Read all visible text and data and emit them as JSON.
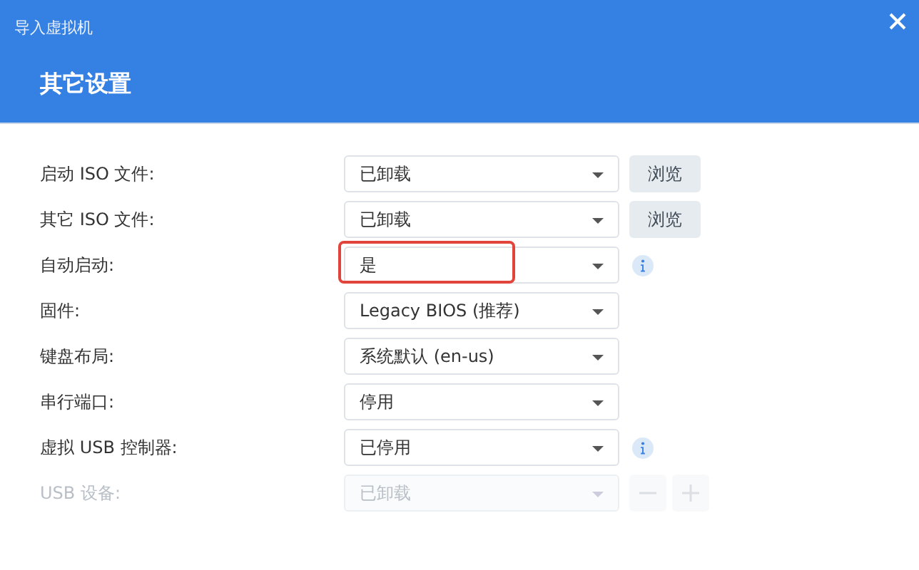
{
  "window": {
    "title": "导入虚拟机"
  },
  "section_title": "其它设置",
  "settings": [
    {
      "label": "启动 ISO 文件:",
      "value": "已卸载",
      "disabled": false,
      "highlighted": false,
      "kind": "browse",
      "button": "浏览"
    },
    {
      "label": "其它 ISO 文件:",
      "value": "已卸载",
      "disabled": false,
      "highlighted": false,
      "kind": "browse",
      "button": "浏览"
    },
    {
      "label": "自动启动:",
      "value": "是",
      "disabled": false,
      "highlighted": true,
      "kind": "info"
    },
    {
      "label": "固件:",
      "value": "Legacy BIOS (推荐)",
      "disabled": false,
      "highlighted": false,
      "kind": "plain"
    },
    {
      "label": "键盘布局:",
      "value": "系统默认 (en-us)",
      "disabled": false,
      "highlighted": false,
      "kind": "plain"
    },
    {
      "label": "串行端口:",
      "value": "停用",
      "disabled": false,
      "highlighted": false,
      "kind": "plain"
    },
    {
      "label": "虚拟 USB 控制器:",
      "value": "已停用",
      "disabled": false,
      "highlighted": false,
      "kind": "info"
    },
    {
      "label": "USB 设备:",
      "value": "已卸载",
      "disabled": true,
      "highlighted": false,
      "kind": "addremove"
    }
  ]
}
